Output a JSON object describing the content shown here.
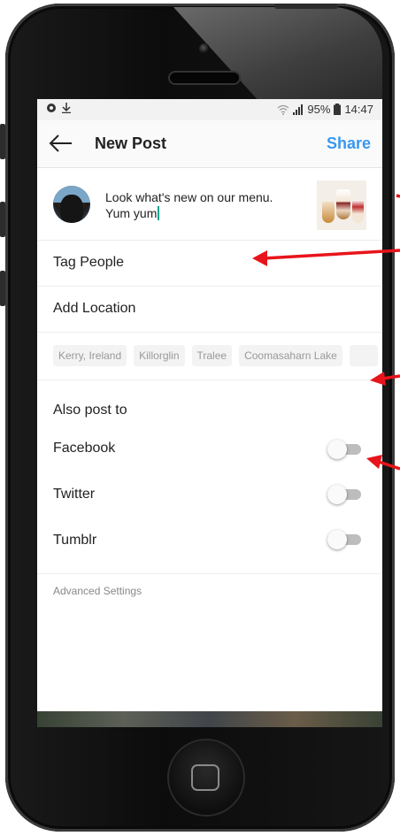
{
  "status_bar": {
    "left_icons": [
      "record-icon",
      "download-icon"
    ],
    "battery": "95%",
    "time": "14:47"
  },
  "app_bar": {
    "title": "New Post",
    "share_label": "Share"
  },
  "post": {
    "caption_line1": "Look what's new on our menu.",
    "caption_line2": "Yum yum"
  },
  "options": {
    "tag_people": "Tag People",
    "add_location": "Add Location"
  },
  "location_chips": [
    "Kerry, Ireland",
    "Killorglin",
    "Tralee",
    "Coomasaharn Lake"
  ],
  "also_post": {
    "header": "Also post to",
    "networks": [
      {
        "label": "Facebook",
        "enabled": false
      },
      {
        "label": "Twitter",
        "enabled": false
      },
      {
        "label": "Tumblr",
        "enabled": false
      }
    ]
  },
  "advanced_settings": "Advanced Settings",
  "colors": {
    "accent": "#3897f0",
    "annotation_arrow": "#e8141b",
    "cursor": "#00a58e"
  }
}
